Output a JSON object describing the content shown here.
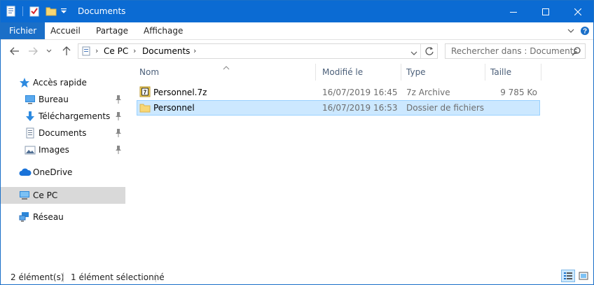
{
  "window": {
    "title": "Documents"
  },
  "ribbon": {
    "tabs": [
      {
        "label": "Fichier",
        "active": true
      },
      {
        "label": "Accueil",
        "active": false
      },
      {
        "label": "Partage",
        "active": false
      },
      {
        "label": "Affichage",
        "active": false
      }
    ]
  },
  "address": {
    "crumbs": [
      "Ce PC",
      "Documents"
    ]
  },
  "search": {
    "placeholder": "Rechercher dans : Documents"
  },
  "nav": {
    "items": [
      {
        "label": "Accès rapide",
        "icon": "star-icon"
      },
      {
        "label": "Bureau",
        "icon": "desktop-icon",
        "pinned": true
      },
      {
        "label": "Téléchargements",
        "icon": "download-icon",
        "pinned": true
      },
      {
        "label": "Documents",
        "icon": "document-icon",
        "pinned": true
      },
      {
        "label": "Images",
        "icon": "images-icon",
        "pinned": true
      },
      {
        "label": "OneDrive",
        "icon": "cloud-icon"
      },
      {
        "label": "Ce PC",
        "icon": "computer-icon",
        "selected": true
      },
      {
        "label": "Réseau",
        "icon": "network-icon"
      }
    ]
  },
  "columns": {
    "name": "Nom",
    "modified": "Modifié le",
    "type": "Type",
    "size": "Taille"
  },
  "files": [
    {
      "name": "Personnel.7z",
      "modified": "16/07/2019 16:45",
      "type": "7z Archive",
      "size": "9 785 Ko",
      "icon": "archive-7z-icon"
    },
    {
      "name": "Personnel",
      "modified": "16/07/2019 16:53",
      "type": "Dossier de fichiers",
      "size": "",
      "icon": "folder-icon",
      "selected": true
    }
  ],
  "status": {
    "count": "2 élément(s)",
    "selection": "1 élément sélectionné"
  },
  "colors": {
    "titlebar": "#0b6bd3",
    "accent": "#1a6fc8",
    "selection": "#cce8ff"
  }
}
